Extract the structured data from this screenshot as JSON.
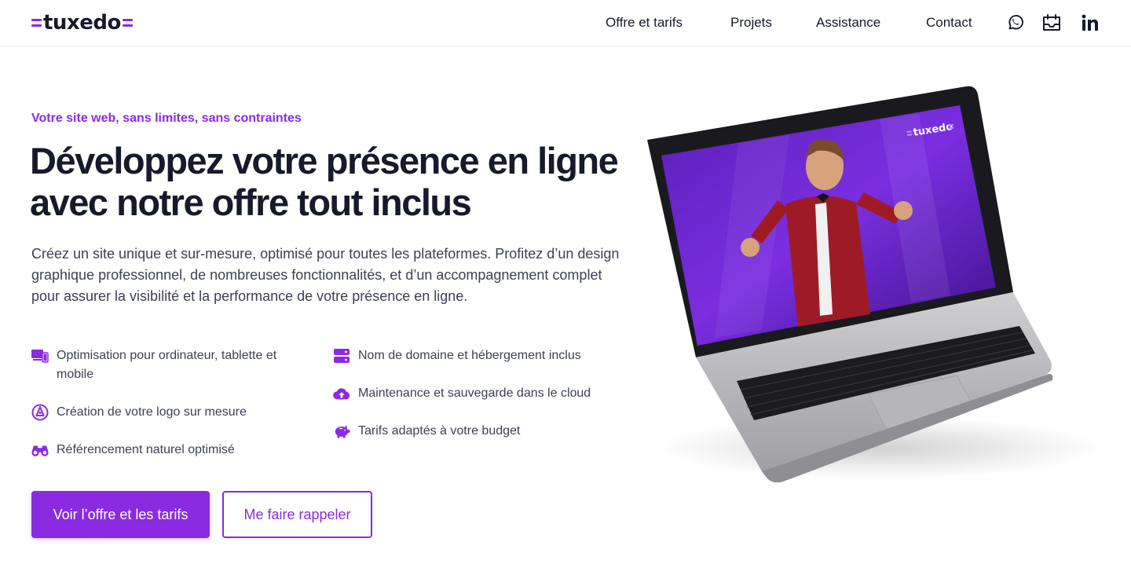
{
  "header": {
    "logo_text": "tuxedo",
    "nav": [
      "Offre et tarifs",
      "Projets",
      "Assistance",
      "Contact"
    ],
    "icons": [
      "whatsapp-icon",
      "calendar-icon",
      "linkedin-icon"
    ]
  },
  "hero": {
    "kicker": "Votre site web, sans limites, sans contraintes",
    "title": "Développez votre présence en ligne avec notre offre tout inclus",
    "lead": "Créez un site unique et sur-mesure, optimisé pour toutes les plateformes. Profitez d’un design graphique professionnel, de nombreuses fonctionnalités, et d’un accompagnement complet pour assurer la visibilité et la performance de votre présence en ligne.",
    "features_left": [
      {
        "icon": "devices-icon",
        "text": "Optimisation pour ordinateur, tablette et mobile"
      },
      {
        "icon": "pen-nib-icon",
        "text": "Création de votre logo sur mesure"
      },
      {
        "icon": "binoculars-icon",
        "text": "Référencement naturel optimisé"
      }
    ],
    "features_right": [
      {
        "icon": "server-icon",
        "text": "Nom de domaine et hébergement inclus"
      },
      {
        "icon": "cloud-upload-icon",
        "text": "Maintenance et sauvegarde dans le cloud"
      },
      {
        "icon": "piggy-bank-icon",
        "text": "Tarifs adaptés à votre budget"
      }
    ],
    "cta_primary": "Voir l’offre et les tarifs",
    "cta_secondary": "Me faire rappeler",
    "screen_logo": "tuxedo"
  },
  "colors": {
    "accent": "#8a2be2",
    "text_dark": "#161a2b",
    "text_body": "#3d4152"
  }
}
